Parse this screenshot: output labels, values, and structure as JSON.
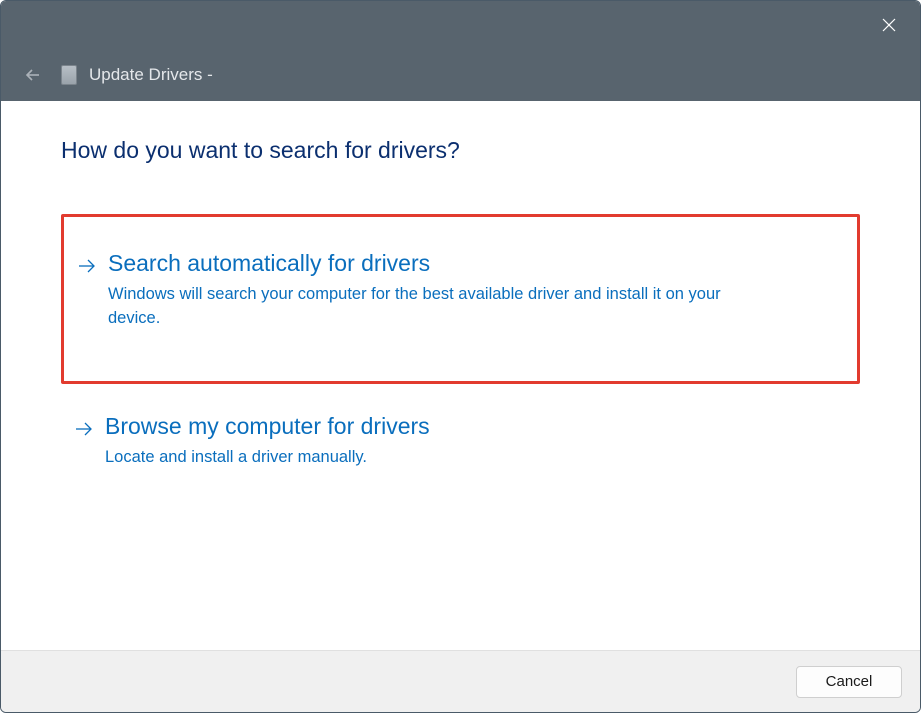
{
  "header": {
    "title": "Update Drivers -"
  },
  "main": {
    "heading": "How do you want to search for drivers?"
  },
  "options": {
    "auto": {
      "title": "Search automatically for drivers",
      "description": "Windows will search your computer for the best available driver and install it on your device."
    },
    "browse": {
      "title": "Browse my computer for drivers",
      "description": "Locate and install a driver manually."
    }
  },
  "footer": {
    "cancel_label": "Cancel"
  }
}
